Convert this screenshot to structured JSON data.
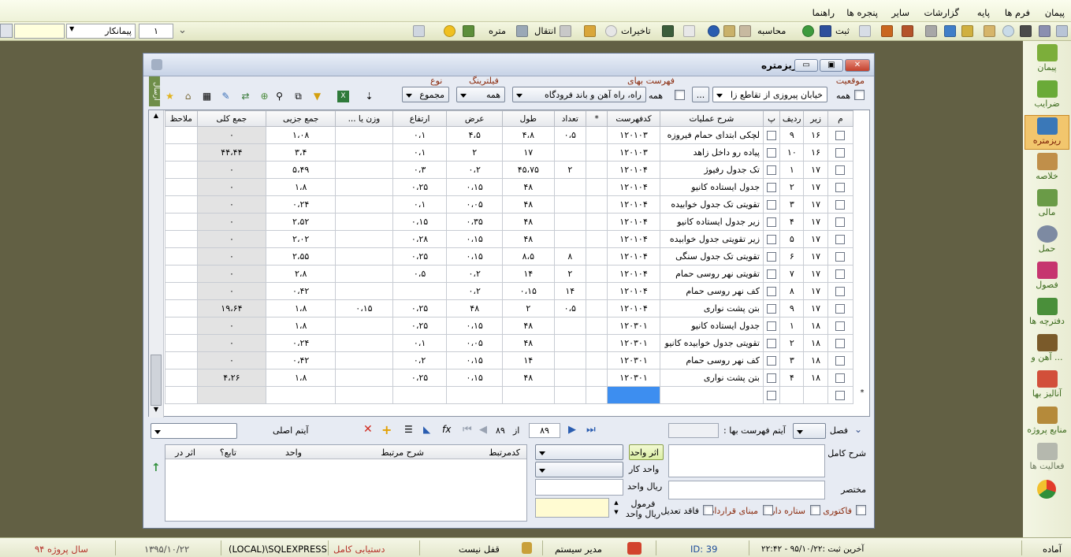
{
  "menubar": {
    "items": [
      "پیمان",
      "فرم ها",
      "پایه",
      "گزارشات",
      "سایر",
      "پنجره ها",
      "راهنما"
    ]
  },
  "toolbar": {
    "project_value": "پیمانکار",
    "record_value": "۱",
    "btn_transfer": "انتقال",
    "btn_meter": "متره",
    "btn_delays": "تاخیرات",
    "btn_calculate": "محاسبه",
    "btn_save": "ثبت"
  },
  "sidebar": {
    "items": [
      "پیمان",
      "ضرایب",
      "ریزمتره",
      "خلاصه",
      "مالی",
      "حمل",
      "فصول",
      "دفترچه ها",
      "آهن و ...",
      "آنالیز بها",
      "منابع پروژه",
      "فعالیت ها"
    ]
  },
  "window": {
    "title": "ریزمتره",
    "filters": {
      "location_label": "موقعیت",
      "location_all": "همه",
      "location_value": "خیابان پیروزی از تقاطع زا",
      "ellipsis": "...",
      "pricelist_label": "فهرست بهای",
      "pricelist_all": "همه",
      "pricelist_value": "راه، راه آهن و باند فرودگاه",
      "filtering_label": "فیلترینگ",
      "filtering_value": "همه",
      "type_label": "نوع",
      "type_value": "مجموع",
      "side_tab": "ارسال"
    },
    "grid": {
      "columns": [
        "م",
        "زیر",
        "ردیف",
        "پ",
        "شرح عملیات",
        "کدفهرست",
        "*",
        "تعداد",
        "طول",
        "عرض",
        "ارتفاع",
        "وزن یا ...",
        "جمع جزیی",
        "جمع کلی",
        "ملاحظ"
      ],
      "rows": [
        [
          "۹",
          "۱۶",
          "لچکی ابتدای حمام فیروزه",
          "۱۲۰۱۰۳",
          "۰،۵",
          "۴،۸",
          "۴،۵",
          "۰،۱",
          "",
          "۱،۰۸",
          "۰"
        ],
        [
          "۱۰",
          "۱۶",
          "پیاده رو داخل زاهد",
          "۱۲۰۱۰۳",
          "",
          "۱۷",
          "۲",
          "۰،۱",
          "",
          "۳،۴",
          "۴۴،۴۴"
        ],
        [
          "۱",
          "۱۷",
          "تک جدول رفیوژ",
          "۱۲۰۱۰۴",
          "۲",
          "۴۵،۷۵",
          "۰،۲",
          "۰،۳",
          "",
          "۵،۴۹",
          "۰"
        ],
        [
          "۲",
          "۱۷",
          "جدول ایستاده کانیو",
          "۱۲۰۱۰۴",
          "",
          "۴۸",
          "۰،۱۵",
          "۰،۲۵",
          "",
          "۱،۸",
          "۰"
        ],
        [
          "۳",
          "۱۷",
          "تقویتی تک جدول خوابیده",
          "۱۲۰۱۰۴",
          "",
          "۴۸",
          "۰،۰۵",
          "۰،۱",
          "",
          "۰،۲۴",
          "۰"
        ],
        [
          "۴",
          "۱۷",
          "زیر جدول ایستاده کانیو",
          "۱۲۰۱۰۴",
          "",
          "۴۸",
          "۰،۳۵",
          "۰،۱۵",
          "",
          "۲،۵۲",
          "۰"
        ],
        [
          "۵",
          "۱۷",
          "زیر تقویتی جدول خوابیده",
          "۱۲۰۱۰۴",
          "",
          "۴۸",
          "۰،۱۵",
          "۰،۲۸",
          "",
          "۲،۰۲",
          "۰"
        ],
        [
          "۶",
          "۱۷",
          "تقویتی تک جدول سنگی",
          "۱۲۰۱۰۴",
          "۸",
          "۸،۵",
          "۰،۱۵",
          "۰،۲۵",
          "",
          "۲،۵۵",
          "۰"
        ],
        [
          "۷",
          "۱۷",
          "تقویتی نهر روسی حمام",
          "۱۲۰۱۰۴",
          "۲",
          "۱۴",
          "۰،۲",
          "۰،۵",
          "",
          "۲،۸",
          "۰"
        ],
        [
          "۸",
          "۱۷",
          "کف نهر روسی حمام",
          "۱۲۰۱۰۴",
          "۱۴",
          "۰،۱۵",
          "۰،۲",
          "",
          "",
          "۰،۴۲",
          "۰"
        ],
        [
          "۹",
          "۱۷",
          "بتن پشت نواری",
          "۱۲۰۱۰۴",
          "۰،۵",
          "۲",
          "۴۸",
          "۰،۲۵",
          "۰،۱۵",
          "۱،۸",
          "۱۹،۶۴"
        ],
        [
          "۱",
          "۱۸",
          "جدول ایستاده کانیو",
          "۱۲۰۳۰۱",
          "",
          "۴۸",
          "۰،۱۵",
          "۰،۲۵",
          "",
          "۱،۸",
          "۰"
        ],
        [
          "۲",
          "۱۸",
          "تقویتی جدول خوابیده کانیو",
          "۱۲۰۳۰۱",
          "",
          "۴۸",
          "۰،۰۵",
          "۰،۱",
          "",
          "۰،۲۴",
          "۰"
        ],
        [
          "۳",
          "۱۸",
          "کف نهر روسی حمام",
          "۱۲۰۳۰۱",
          "",
          "۱۴",
          "۰،۱۵",
          "۰،۲",
          "",
          "۰،۴۲",
          "۰"
        ],
        [
          "۴",
          "۱۸",
          "بتن پشت نواری",
          "۱۲۰۳۰۱",
          "",
          "۴۸",
          "۰،۱۵",
          "۰،۲۵",
          "",
          "۱،۸",
          "۴،۲۶"
        ]
      ],
      "new_row_marker": "*"
    },
    "nav": {
      "season_label": "فصل :",
      "pricelist_item_label": "آیتم فهرست بها :",
      "current_page": "۸۹",
      "of_label": "از",
      "total_pages": "۸۹",
      "main_item_label": "آیتم اصلی"
    },
    "details": {
      "full_desc_label": "شرح کامل",
      "short_label": "مختصر",
      "unit_effect_btn": "اثر واحد",
      "unit_work_label": "واحد کار",
      "unit_rial_label": "ریال واحد",
      "formula_label": "فرمول ریال واحد",
      "checks": [
        "فاکتوری",
        "ستاره دار",
        "مبنای قرارداد",
        "فاقد تعدیل"
      ],
      "related_columns": [
        "کدمرتبط",
        "شرح مرتبط",
        "واحد",
        "تابع؟",
        "اثر در"
      ]
    }
  },
  "status": {
    "ready": "آماده",
    "last_record": "آخرین ثبت :۹۵/۱۰/۲۲ - ۲۲:۴۲",
    "id": "ID: 39",
    "user": "مدیر سیستم",
    "lock": "قفل نیست",
    "access": "دستیابی کامل",
    "server": "(LOCAL)\\SQLEXPRESS",
    "date": "۱۳۹۵/۱۰/۲۲",
    "project_year": "سال پروژه ۹۴"
  }
}
